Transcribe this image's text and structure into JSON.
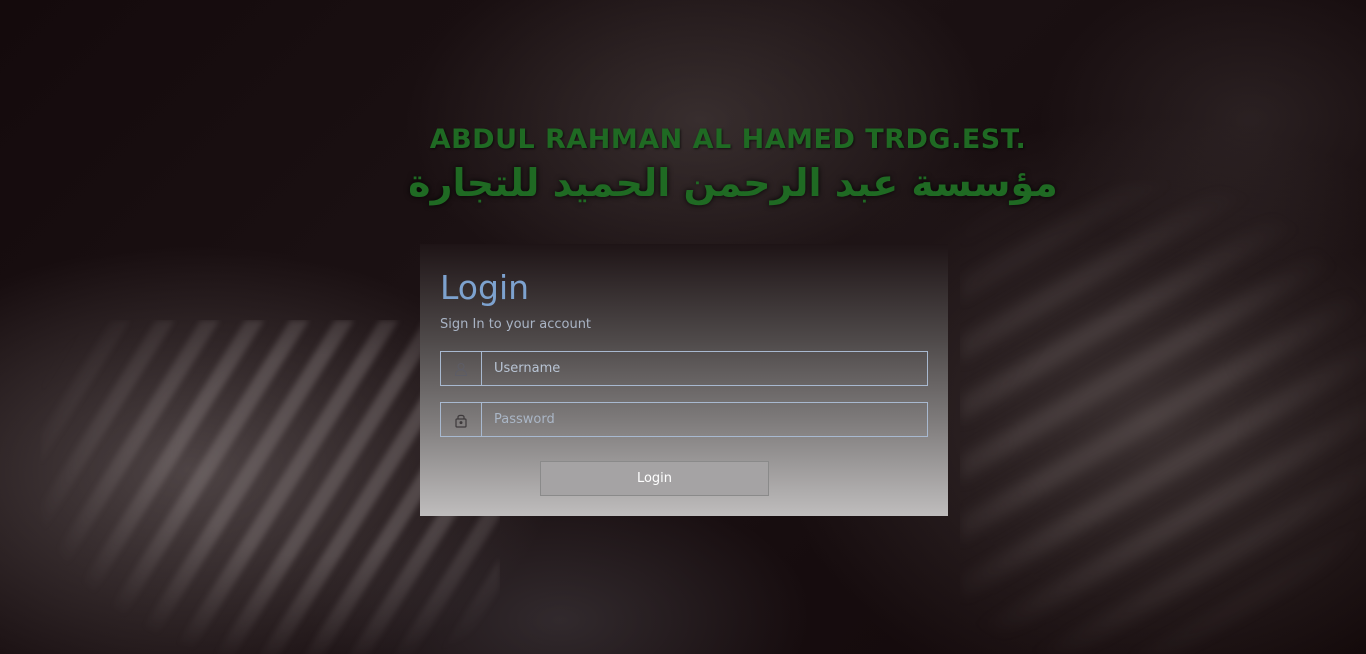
{
  "brand": {
    "name_en": "ABDUL RAHMAN AL HAMED TRDG.EST.",
    "name_ar": "مؤسسة عبد الرحمن الحميد للتجارة",
    "color": "#1f6a23"
  },
  "login": {
    "title": "Login",
    "subtitle": "Sign In to your account",
    "username": {
      "placeholder": "Username",
      "value": "",
      "icon": "user-icon"
    },
    "password": {
      "placeholder": "Password",
      "value": "",
      "icon": "lock-icon"
    },
    "submit_label": "Login",
    "title_color": "#7da2cf"
  }
}
